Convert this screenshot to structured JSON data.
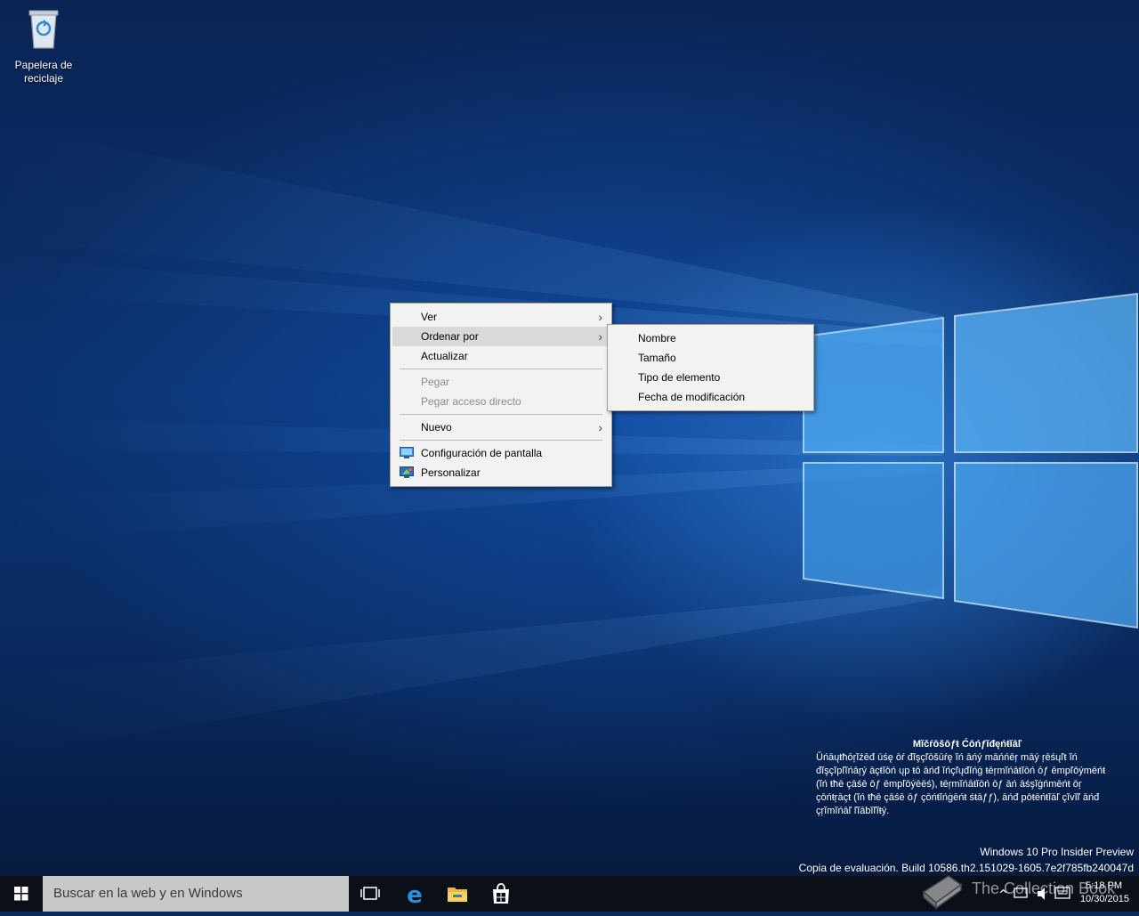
{
  "desktop": {
    "icons": [
      {
        "label": "Papelera de reciclaje",
        "icon": "recycle-bin-icon"
      }
    ]
  },
  "context_menu": {
    "items": [
      {
        "label": "Ver",
        "submenu": true,
        "enabled": true
      },
      {
        "label": "Ordenar por",
        "submenu": true,
        "enabled": true,
        "highlighted": true
      },
      {
        "label": "Actualizar",
        "enabled": true
      },
      {
        "label": "Pegar",
        "enabled": false
      },
      {
        "label": "Pegar acceso directo",
        "enabled": false
      },
      {
        "label": "Nuevo",
        "submenu": true,
        "enabled": true
      },
      {
        "label": "Configuración de pantalla",
        "icon": "display-settings-icon",
        "enabled": true
      },
      {
        "label": "Personalizar",
        "icon": "personalize-icon",
        "enabled": true
      }
    ],
    "arrow_glyph": "›"
  },
  "submenu": {
    "items": [
      {
        "label": "Nombre"
      },
      {
        "label": "Tamaño"
      },
      {
        "label": "Tipo de elemento"
      },
      {
        "label": "Fecha de modificación"
      }
    ]
  },
  "watermark": {
    "title": "Mĭčŕōšōƒŧ Ćōńƒĭđęńŧĭāľ",
    "body": "Ŭńāųŧħōŗĭźēđ ūśę ōŕ đĭşçľōšūŕę ĭń āńý māńńēŗ māý ŗēśųľŧ ĭń đĭşçĭpľĭńāŗý āçŧĭōń ųp ŧō āńđ ĭńçľųđĭńġ ŧēŗmĭńāŧĭōń ōƒ ēmpľōýmēńŧ (ĭń ŧħē çāśē ōƒ ēmpľōýēēś), ŧēŗmĭńāŧĭōń ōƒ āń āśşĭġńmēńŧ ōŗ çōńŧŗāçŧ (ĭń ŧħē çāśē ōƒ çōńŧĭńġēńŧ śŧāƒƒ), āńđ pōŧēńŧĭāľ çĭvĭľ āńđ çŗĭmĭńāľ ľĭāƅĭľĭŧý."
  },
  "edition": {
    "line1": "Windows 10 Pro Insider Preview",
    "line2": "Copia de evaluación. Build 10586.th2.151029-1605.7e2f785fb240047d"
  },
  "taskbar": {
    "search_placeholder": "Buscar en la web y en Windows",
    "icons": [
      "windows-start-icon",
      "task-view-icon",
      "edge-icon",
      "file-explorer-icon",
      "store-icon"
    ],
    "time": "5:18 PM",
    "date": "10/30/2015"
  },
  "overlay_logo": "The Collection Book",
  "colors": {
    "menu_bg": "#f2f2f2",
    "menu_highlight": "#d9d9d9",
    "disabled_text": "#8c8c8c",
    "taskbar": "#0b0f18",
    "search_bg": "#c8c8c8"
  }
}
